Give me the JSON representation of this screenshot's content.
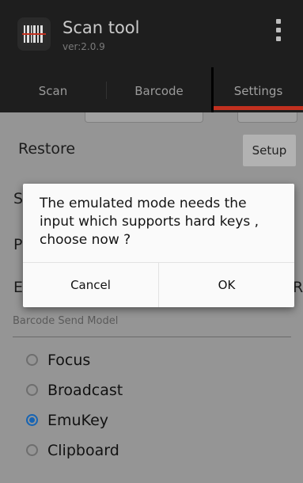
{
  "app": {
    "title": "Scan tool",
    "version": "ver:2.0.9",
    "icon": "barcode-app-icon",
    "overflow_icon": "overflow-menu-icon"
  },
  "tabs": [
    {
      "label": "Scan",
      "active": false
    },
    {
      "label": "Barcode",
      "active": false
    },
    {
      "label": "Settings",
      "active": true
    }
  ],
  "settings": {
    "restore_label": "Restore",
    "setup_label": "Setup",
    "partial_label_s": "S",
    "partial_label_p": "P",
    "partial_label_e": "E",
    "partial_right_r": "R",
    "section_header": "Barcode Send Model",
    "send_model_options": [
      {
        "label": "Focus",
        "checked": false
      },
      {
        "label": "Broadcast",
        "checked": false
      },
      {
        "label": "EmuKey",
        "checked": true
      },
      {
        "label": "Clipboard",
        "checked": false
      }
    ]
  },
  "dialog": {
    "message": "The emulated mode needs the input which supports hard keys , choose now ?",
    "cancel_label": "Cancel",
    "ok_label": "OK"
  },
  "colors": {
    "accent": "#c2301f",
    "radio_checked": "#1764b3",
    "toolbar": "#1e1e1e"
  }
}
